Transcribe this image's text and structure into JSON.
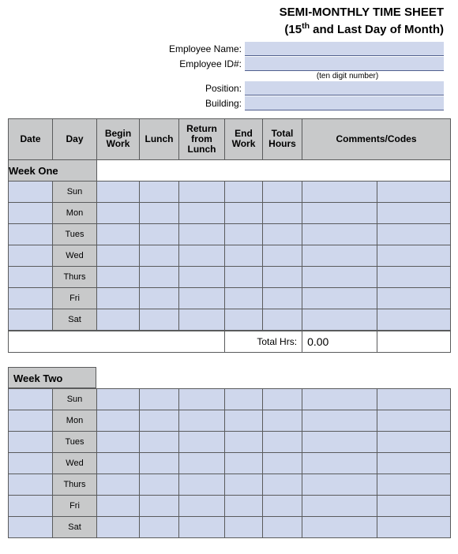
{
  "title_line1": "SEMI-MONTHLY TIME SHEET",
  "title_line2_pre": "(15",
  "title_line2_sup": "th",
  "title_line2_post": " and Last Day of Month)",
  "meta": {
    "employee_name_label": "Employee Name:",
    "employee_id_label": "Employee ID#:",
    "id_hint": "(ten digit number)",
    "position_label": "Position:",
    "building_label": "Building:"
  },
  "headers": {
    "date": "Date",
    "day": "Day",
    "begin": "Begin Work",
    "lunch": "Lunch",
    "return": "Return from Lunch",
    "end": "End Work",
    "total": "Total Hours",
    "comments": "Comments/Codes"
  },
  "section_week_one": "Week One",
  "section_week_two": "Week Two",
  "days": [
    "Sun",
    "Mon",
    "Tues",
    "Wed",
    "Thurs",
    "Fri",
    "Sat"
  ],
  "total_hrs_label": "Total Hrs:",
  "total_hrs_value": "0.00"
}
